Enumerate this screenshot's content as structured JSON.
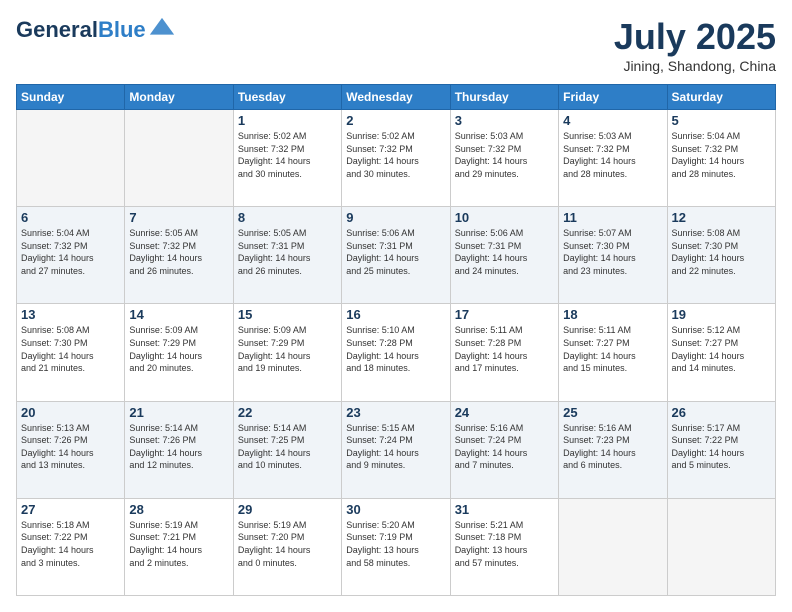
{
  "header": {
    "logo_line1": "General",
    "logo_line2": "Blue",
    "month_title": "July 2025",
    "location": "Jining, Shandong, China"
  },
  "weekdays": [
    "Sunday",
    "Monday",
    "Tuesday",
    "Wednesday",
    "Thursday",
    "Friday",
    "Saturday"
  ],
  "weeks": [
    [
      {
        "day": "",
        "info": ""
      },
      {
        "day": "",
        "info": ""
      },
      {
        "day": "1",
        "info": "Sunrise: 5:02 AM\nSunset: 7:32 PM\nDaylight: 14 hours\nand 30 minutes."
      },
      {
        "day": "2",
        "info": "Sunrise: 5:02 AM\nSunset: 7:32 PM\nDaylight: 14 hours\nand 30 minutes."
      },
      {
        "day": "3",
        "info": "Sunrise: 5:03 AM\nSunset: 7:32 PM\nDaylight: 14 hours\nand 29 minutes."
      },
      {
        "day": "4",
        "info": "Sunrise: 5:03 AM\nSunset: 7:32 PM\nDaylight: 14 hours\nand 28 minutes."
      },
      {
        "day": "5",
        "info": "Sunrise: 5:04 AM\nSunset: 7:32 PM\nDaylight: 14 hours\nand 28 minutes."
      }
    ],
    [
      {
        "day": "6",
        "info": "Sunrise: 5:04 AM\nSunset: 7:32 PM\nDaylight: 14 hours\nand 27 minutes."
      },
      {
        "day": "7",
        "info": "Sunrise: 5:05 AM\nSunset: 7:32 PM\nDaylight: 14 hours\nand 26 minutes."
      },
      {
        "day": "8",
        "info": "Sunrise: 5:05 AM\nSunset: 7:31 PM\nDaylight: 14 hours\nand 26 minutes."
      },
      {
        "day": "9",
        "info": "Sunrise: 5:06 AM\nSunset: 7:31 PM\nDaylight: 14 hours\nand 25 minutes."
      },
      {
        "day": "10",
        "info": "Sunrise: 5:06 AM\nSunset: 7:31 PM\nDaylight: 14 hours\nand 24 minutes."
      },
      {
        "day": "11",
        "info": "Sunrise: 5:07 AM\nSunset: 7:30 PM\nDaylight: 14 hours\nand 23 minutes."
      },
      {
        "day": "12",
        "info": "Sunrise: 5:08 AM\nSunset: 7:30 PM\nDaylight: 14 hours\nand 22 minutes."
      }
    ],
    [
      {
        "day": "13",
        "info": "Sunrise: 5:08 AM\nSunset: 7:30 PM\nDaylight: 14 hours\nand 21 minutes."
      },
      {
        "day": "14",
        "info": "Sunrise: 5:09 AM\nSunset: 7:29 PM\nDaylight: 14 hours\nand 20 minutes."
      },
      {
        "day": "15",
        "info": "Sunrise: 5:09 AM\nSunset: 7:29 PM\nDaylight: 14 hours\nand 19 minutes."
      },
      {
        "day": "16",
        "info": "Sunrise: 5:10 AM\nSunset: 7:28 PM\nDaylight: 14 hours\nand 18 minutes."
      },
      {
        "day": "17",
        "info": "Sunrise: 5:11 AM\nSunset: 7:28 PM\nDaylight: 14 hours\nand 17 minutes."
      },
      {
        "day": "18",
        "info": "Sunrise: 5:11 AM\nSunset: 7:27 PM\nDaylight: 14 hours\nand 15 minutes."
      },
      {
        "day": "19",
        "info": "Sunrise: 5:12 AM\nSunset: 7:27 PM\nDaylight: 14 hours\nand 14 minutes."
      }
    ],
    [
      {
        "day": "20",
        "info": "Sunrise: 5:13 AM\nSunset: 7:26 PM\nDaylight: 14 hours\nand 13 minutes."
      },
      {
        "day": "21",
        "info": "Sunrise: 5:14 AM\nSunset: 7:26 PM\nDaylight: 14 hours\nand 12 minutes."
      },
      {
        "day": "22",
        "info": "Sunrise: 5:14 AM\nSunset: 7:25 PM\nDaylight: 14 hours\nand 10 minutes."
      },
      {
        "day": "23",
        "info": "Sunrise: 5:15 AM\nSunset: 7:24 PM\nDaylight: 14 hours\nand 9 minutes."
      },
      {
        "day": "24",
        "info": "Sunrise: 5:16 AM\nSunset: 7:24 PM\nDaylight: 14 hours\nand 7 minutes."
      },
      {
        "day": "25",
        "info": "Sunrise: 5:16 AM\nSunset: 7:23 PM\nDaylight: 14 hours\nand 6 minutes."
      },
      {
        "day": "26",
        "info": "Sunrise: 5:17 AM\nSunset: 7:22 PM\nDaylight: 14 hours\nand 5 minutes."
      }
    ],
    [
      {
        "day": "27",
        "info": "Sunrise: 5:18 AM\nSunset: 7:22 PM\nDaylight: 14 hours\nand 3 minutes."
      },
      {
        "day": "28",
        "info": "Sunrise: 5:19 AM\nSunset: 7:21 PM\nDaylight: 14 hours\nand 2 minutes."
      },
      {
        "day": "29",
        "info": "Sunrise: 5:19 AM\nSunset: 7:20 PM\nDaylight: 14 hours\nand 0 minutes."
      },
      {
        "day": "30",
        "info": "Sunrise: 5:20 AM\nSunset: 7:19 PM\nDaylight: 13 hours\nand 58 minutes."
      },
      {
        "day": "31",
        "info": "Sunrise: 5:21 AM\nSunset: 7:18 PM\nDaylight: 13 hours\nand 57 minutes."
      },
      {
        "day": "",
        "info": ""
      },
      {
        "day": "",
        "info": ""
      }
    ]
  ]
}
